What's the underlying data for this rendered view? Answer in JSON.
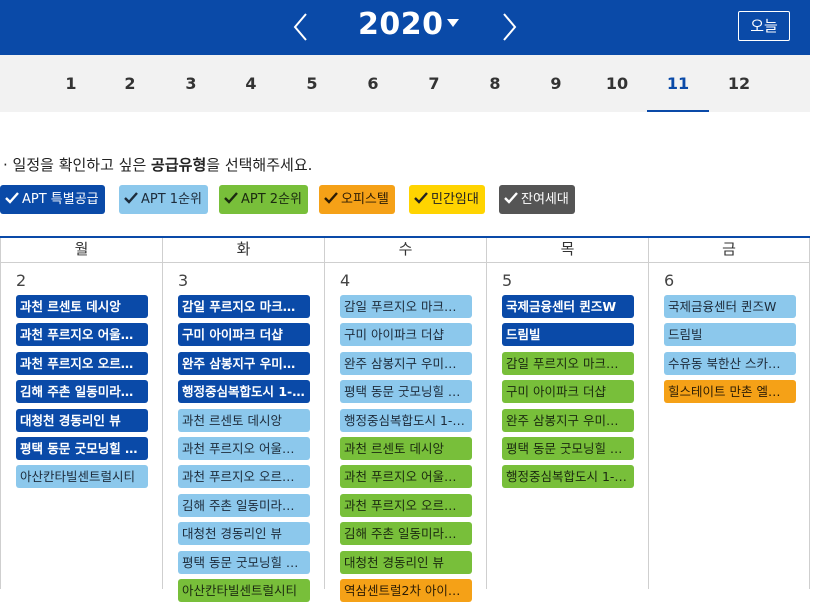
{
  "header": {
    "year": "2020",
    "today_label": "오늘",
    "prev_icon": "chevron-left-icon",
    "next_icon": "chevron-right-icon",
    "dropdown_icon": "caret-down-icon",
    "colors": {
      "bar": "#0a4aa8",
      "text": "#ffffff"
    }
  },
  "months": [
    "1",
    "2",
    "3",
    "4",
    "5",
    "6",
    "7",
    "8",
    "9",
    "10",
    "11",
    "12"
  ],
  "active_month": "11",
  "notice": {
    "prefix": "· 일정을 확인하고 싶은 ",
    "bold": "공급유형",
    "suffix": "을 선택해주세요."
  },
  "filters": [
    {
      "label": "APT 특별공급",
      "color": "#0a4aa8"
    },
    {
      "label": "APT 1순위",
      "color": "#8cc8ec"
    },
    {
      "label": "APT 2순위",
      "color": "#78bf3a"
    },
    {
      "label": "오피스텔",
      "color": "#f5a117"
    },
    {
      "label": "민간임대",
      "color": "#ffd400"
    },
    {
      "label": "잔여세대",
      "color": "#555555"
    }
  ],
  "weekdays": [
    "월",
    "화",
    "수",
    "목",
    "금"
  ],
  "days": [
    {
      "date": "2",
      "events": [
        {
          "text": "과천 르센토 데시앙",
          "color": "navy"
        },
        {
          "text": "과천 푸르지오 어울…",
          "color": "navy"
        },
        {
          "text": "과천 푸르지오 오르…",
          "color": "navy"
        },
        {
          "text": "김해 주촌 일동미라…",
          "color": "navy"
        },
        {
          "text": "대청천 경동리인 뷰",
          "color": "navy"
        },
        {
          "text": "평택 동문 굿모닝힐 …",
          "color": "navy"
        },
        {
          "text": "아산칸타빌센트럴시티",
          "color": "sky"
        }
      ]
    },
    {
      "date": "3",
      "events": [
        {
          "text": "감일 푸르지오 마크…",
          "color": "navy"
        },
        {
          "text": "구미 아이파크 더샵",
          "color": "navy"
        },
        {
          "text": "완주 삼봉지구 우미…",
          "color": "navy"
        },
        {
          "text": "행정중심복합도시 1-…",
          "color": "navy"
        },
        {
          "text": "과천 르센토 데시앙",
          "color": "sky"
        },
        {
          "text": "과천 푸르지오 어울…",
          "color": "sky"
        },
        {
          "text": "과천 푸르지오 오르…",
          "color": "sky"
        },
        {
          "text": "김해 주촌 일동미라…",
          "color": "sky"
        },
        {
          "text": "대청천 경동리인 뷰",
          "color": "sky"
        },
        {
          "text": "평택 동문 굿모닝힐 …",
          "color": "sky"
        },
        {
          "text": "아산칸타빌센트럴시티",
          "color": "green"
        }
      ]
    },
    {
      "date": "4",
      "events": [
        {
          "text": "감일 푸르지오 마크…",
          "color": "sky"
        },
        {
          "text": "구미 아이파크 더샵",
          "color": "sky"
        },
        {
          "text": "완주 삼봉지구 우미…",
          "color": "sky"
        },
        {
          "text": "평택 동문 굿모닝힐 …",
          "color": "sky"
        },
        {
          "text": "행정중심복합도시 1-…",
          "color": "sky"
        },
        {
          "text": "과천 르센토 데시앙",
          "color": "green"
        },
        {
          "text": "과천 푸르지오 어울…",
          "color": "green"
        },
        {
          "text": "과천 푸르지오 오르…",
          "color": "green"
        },
        {
          "text": "김해 주촌 일동미라…",
          "color": "green"
        },
        {
          "text": "대청천 경동리인 뷰",
          "color": "green"
        },
        {
          "text": "역삼센트럴2차 아이…",
          "color": "orange"
        }
      ]
    },
    {
      "date": "5",
      "events": [
        {
          "text": "국제금융센터 퀸즈W",
          "color": "navy"
        },
        {
          "text": "드림빌",
          "color": "navy"
        },
        {
          "text": "감일 푸르지오 마크…",
          "color": "green"
        },
        {
          "text": "구미 아이파크 더샵",
          "color": "green"
        },
        {
          "text": "완주 삼봉지구 우미…",
          "color": "green"
        },
        {
          "text": "평택 동문 굿모닝힐 …",
          "color": "green"
        },
        {
          "text": "행정중심복합도시 1-…",
          "color": "green"
        }
      ]
    },
    {
      "date": "6",
      "events": [
        {
          "text": "국제금융센터 퀸즈W",
          "color": "sky"
        },
        {
          "text": "드림빌",
          "color": "sky"
        },
        {
          "text": "수유동 북한산 스카…",
          "color": "sky"
        },
        {
          "text": "힐스테이트 만촌 엘…",
          "color": "orange"
        }
      ]
    }
  ]
}
